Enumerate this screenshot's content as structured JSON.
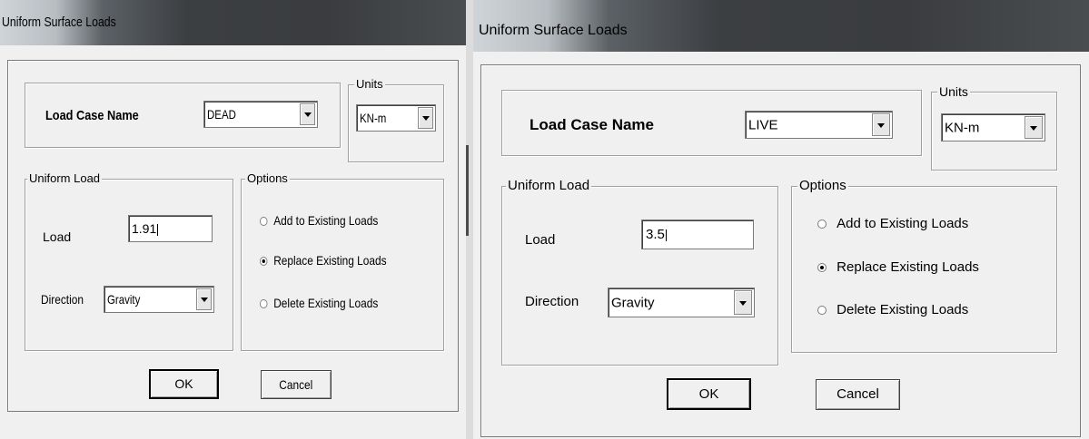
{
  "left": {
    "title": "Uniform Surface Loads",
    "load_case_label": "Load Case Name",
    "load_case_value": "DEAD",
    "units_legend": "Units",
    "units_value": "KN-m",
    "uniform_legend": "Uniform Load",
    "load_label": "Load",
    "load_value": "1.91",
    "direction_label": "Direction",
    "direction_value": "Gravity",
    "options_legend": "Options",
    "opt_add": "Add to Existing Loads",
    "opt_replace": "Replace Existing Loads",
    "opt_delete": "Delete Existing Loads",
    "selected_option": "replace",
    "ok_label": "OK",
    "cancel_label": "Cancel"
  },
  "right": {
    "title": "Uniform Surface Loads",
    "load_case_label": "Load Case Name",
    "load_case_value": "LIVE",
    "units_legend": "Units",
    "units_value": "KN-m",
    "uniform_legend": "Uniform Load",
    "load_label": "Load",
    "load_value": "3.5",
    "direction_label": "Direction",
    "direction_value": "Gravity",
    "options_legend": "Options",
    "opt_add": "Add to Existing Loads",
    "opt_replace": "Replace Existing Loads",
    "opt_delete": "Delete Existing Loads",
    "selected_option": "replace",
    "ok_label": "OK",
    "cancel_label": "Cancel"
  }
}
